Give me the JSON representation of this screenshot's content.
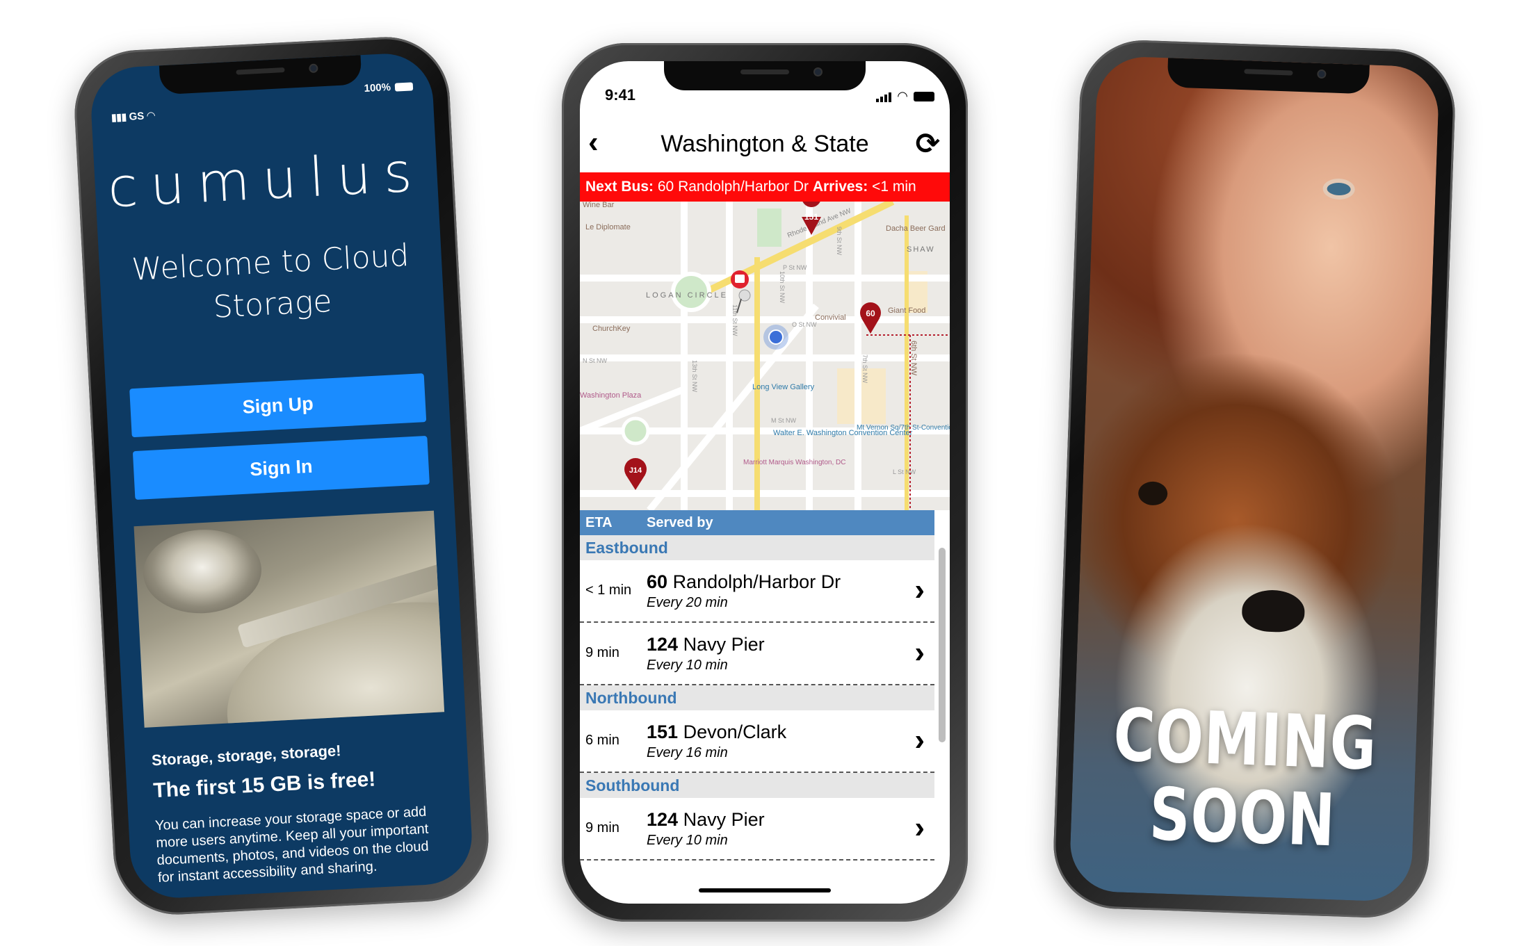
{
  "left_phone": {
    "status": {
      "carrier": "GS",
      "battery": "100%"
    },
    "logo": "cumulus",
    "welcome": "Welcome to Cloud Storage",
    "signup_label": "Sign Up",
    "signin_label": "Sign In",
    "tagline": "Storage, storage, storage!",
    "headline": "The first 15 GB is free!",
    "description": "You can increase your storage space or add more users anytime. Keep all your important documents, photos, and videos on the cloud for instant accessibility and sharing."
  },
  "middle_phone": {
    "status": {
      "time": "9:41"
    },
    "title": "Washington & State",
    "next_bus": {
      "label": "Next Bus:",
      "route": "60 Randolph/Harbor Dr",
      "arrives_label": "Arrives:",
      "arrives_value": "<1 min"
    },
    "map_labels": {
      "pin_151": "151",
      "pin_60": "60",
      "pin_j14": "J14",
      "wine_bar": "Wine Bar",
      "le_diplomate": "Le Diplomate",
      "dacha": "Dacha Beer Gard",
      "shaw": "SHAW",
      "logan": "LOGAN CIRCLE",
      "churchkey": "ChurchKey",
      "convivial": "Convivial",
      "giant": "Giant Food",
      "rhode": "Rhode Island Ave NW",
      "longview": "Long View Gallery",
      "wash_plaza": "Washington Plaza",
      "convention": "Walter E. Washington Convention Center",
      "mtvernon": "Mt Vernon Sq/7th St-Convention Cen",
      "marriott": "Marriott Marquis Washington, DC",
      "street_p": "P St NW",
      "street_o": "O St NW",
      "street_n": "N St NW",
      "street_m": "M St NW",
      "street_l": "L St NW",
      "st_13": "13th St NW",
      "st_11": "11th St NW",
      "st_10": "10th St NW",
      "st_9": "9th St NW",
      "st_7": "7th St NW",
      "st_6": "6th St NW"
    },
    "table_header": {
      "eta": "ETA",
      "served_by": "Served by"
    },
    "sections": [
      {
        "name": "Eastbound",
        "rows": [
          {
            "eta": "< 1 min",
            "route_num": "60",
            "route_name": "Randolph/Harbor Dr",
            "frequency": "Every 20 min"
          },
          {
            "eta": "9 min",
            "route_num": "124",
            "route_name": "Navy Pier",
            "frequency": "Every 10 min"
          }
        ]
      },
      {
        "name": "Northbound",
        "rows": [
          {
            "eta": "6 min",
            "route_num": "151",
            "route_name": "Devon/Clark",
            "frequency": "Every 16 min"
          }
        ]
      },
      {
        "name": "Southbound",
        "rows": [
          {
            "eta": "9 min",
            "route_num": "124",
            "route_name": "Navy Pier",
            "frequency": "Every 10 min"
          }
        ]
      }
    ]
  },
  "right_phone": {
    "line1": "COMING",
    "line2": "SOON"
  },
  "colors": {
    "cumulus_bg": "#0d3a63",
    "cumulus_button": "#1a8cff",
    "next_bus_red": "#ff0a0a",
    "table_header_blue": "#4f88c0",
    "section_text_blue": "#3a78b4",
    "pin_red": "#a3121a"
  },
  "icons": [
    "back-chevron-icon",
    "refresh-icon",
    "chevron-right-icon",
    "wifi-icon",
    "signal-icon",
    "battery-icon",
    "map-pin-icon",
    "bus-stop-icon",
    "location-dot-icon"
  ]
}
